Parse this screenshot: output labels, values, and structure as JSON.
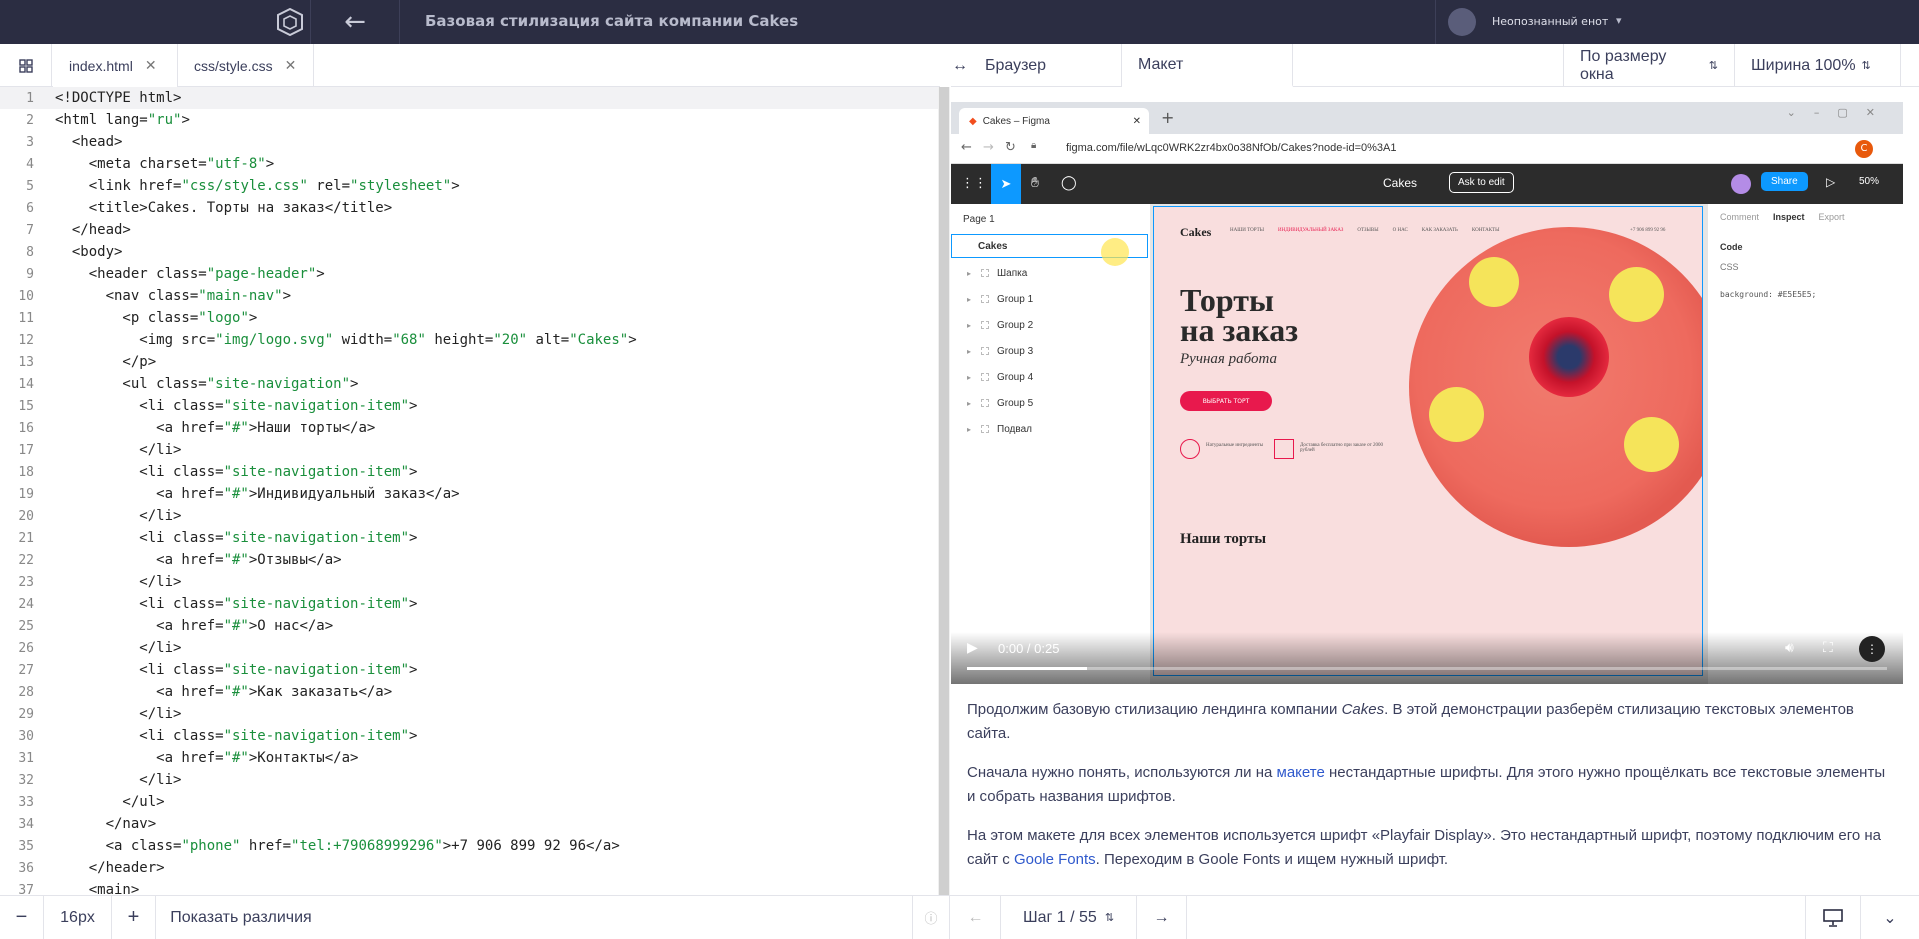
{
  "topbar": {
    "title": "Базовая стилизация сайта компании Cakes",
    "back_icon": "←",
    "user_name": "Неопознанный енот",
    "user_caret": "▾"
  },
  "editor": {
    "tabs": [
      {
        "label": "index.html",
        "close": "✕"
      },
      {
        "label": "css/style.css",
        "close": "✕"
      }
    ],
    "lines": [
      "<!DOCTYPE html>",
      "<html lang=\"ru\">",
      "  <head>",
      "    <meta charset=\"utf-8\">",
      "    <link href=\"css/style.css\" rel=\"stylesheet\">",
      "    <title>Cakes. Торты на заказ</title>",
      "  </head>",
      "  <body>",
      "    <header class=\"page-header\">",
      "      <nav class=\"main-nav\">",
      "        <p class=\"logo\">",
      "          <img src=\"img/logo.svg\" width=\"68\" height=\"20\" alt=\"Cakes\">",
      "        </p>",
      "        <ul class=\"site-navigation\">",
      "          <li class=\"site-navigation-item\">",
      "            <a href=\"#\">Наши торты</a>",
      "          </li>",
      "          <li class=\"site-navigation-item\">",
      "            <a href=\"#\">Индивидуальный заказ</a>",
      "          </li>",
      "          <li class=\"site-navigation-item\">",
      "            <a href=\"#\">Отзывы</a>",
      "          </li>",
      "          <li class=\"site-navigation-item\">",
      "            <a href=\"#\">О нас</a>",
      "          </li>",
      "          <li class=\"site-navigation-item\">",
      "            <a href=\"#\">Как заказать</a>",
      "          </li>",
      "          <li class=\"site-navigation-item\">",
      "            <a href=\"#\">Контакты</a>",
      "          </li>",
      "        </ul>",
      "      </nav>",
      "      <a class=\"phone\" href=\"tel:+79068999296\">+7 906 899 92 96</a>",
      "    </header>",
      "    <main>"
    ]
  },
  "bottom": {
    "minus": "−",
    "font_size": "16px",
    "plus": "+",
    "diff_label": "Показать различия",
    "step_label": "Шаг 1 / 55",
    "prev": "←",
    "next": "→"
  },
  "right_tabs": {
    "browser": "Браузер",
    "layout": "Макет",
    "fit": "По размеру окна",
    "width": "Ширина 100%"
  },
  "browser_mock": {
    "tab_title": "Cakes – Figma",
    "url": "figma.com/file/wLqc0WRK2zr4bx0o38NfOb/Cakes?node-id=0%3A1",
    "profile": "C"
  },
  "figma": {
    "file": "Cakes",
    "ask": "Ask to edit",
    "share": "Share",
    "zoom": "50%",
    "page": "Page 1",
    "frame": "Cakes",
    "layers": [
      "Шапка",
      "Group 1",
      "Group 2",
      "Group 3",
      "Group 4",
      "Group 5",
      "Подвал"
    ],
    "inspect_tabs": [
      "Comment",
      "Inspect",
      "Export"
    ],
    "code_label": "Code",
    "code_lang": "CSS",
    "code_line": "background: #E5E5E5;"
  },
  "design": {
    "logo": "Cakes",
    "nav": [
      "НАШИ ТОРТЫ",
      "ИНДИВИДУАЛЬНЫЙ ЗАКАЗ",
      "ОТЗЫВЫ",
      "О НАС",
      "КАК ЗАКАЗАТЬ",
      "КОНТАКТЫ"
    ],
    "phone": "+7 906 899 92 96",
    "heading1": "Торты",
    "heading2": "на заказ",
    "subtitle": "Ручная работа",
    "cta": "ВЫБРАТЬ ТОРТ",
    "feat1": "Натуральные ингредиенты",
    "feat2": "Доставка бесплатно при заказе от 2000 рублей",
    "section": "Наши торты"
  },
  "video": {
    "time": "0:00 / 0:25",
    "progress": 0.13
  },
  "article": {
    "p1a": "Продолжим базовую стилизацию лендинга компании ",
    "p1b": "Cakes",
    "p1c": ". В этой демонстрации разберём стилизацию текстовых элементов сайта.",
    "p2a": "Сначала нужно понять, используются ли на ",
    "p2link": "макете",
    "p2b": " нестандартные шрифты. Для этого нужно прощёлкать все текстовые элементы и собрать названия шрифтов.",
    "p3a": "На этом макете для всех элементов используется шрифт «Playfair Display». Это нестандартный шрифт, поэтому подключим его на сайт с ",
    "p3link": "Goole Fonts",
    "p3b": ". Переходим в Goole Fonts и ищем нужный шрифт."
  }
}
